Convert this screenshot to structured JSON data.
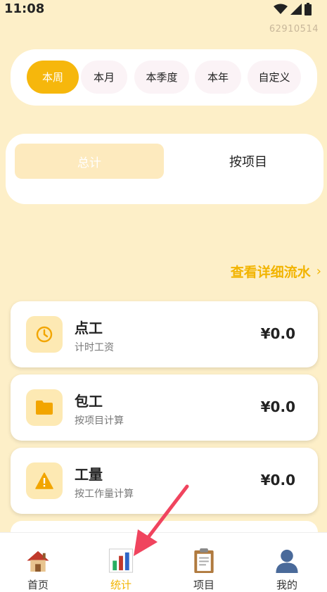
{
  "status_bar": {
    "time": "11:08"
  },
  "device_id": "62910514",
  "periods": [
    {
      "label": "本周",
      "active": true
    },
    {
      "label": "本月",
      "active": false
    },
    {
      "label": "本季度",
      "active": false
    },
    {
      "label": "本年",
      "active": false
    },
    {
      "label": "自定义",
      "active": false
    }
  ],
  "tabs": {
    "total_label": "总计",
    "by_project_label": "按项目"
  },
  "detail_link": {
    "label": "查看详细流水",
    "chevron": "›"
  },
  "stats": [
    {
      "title": "点工",
      "subtitle": "计时工资",
      "amount": "¥0.0",
      "icon": "clock-icon"
    },
    {
      "title": "包工",
      "subtitle": "按项目计算",
      "amount": "¥0.0",
      "icon": "folder-icon"
    },
    {
      "title": "工量",
      "subtitle": "按工作量计算",
      "amount": "¥0.0",
      "icon": "warning-icon"
    }
  ],
  "nav": [
    {
      "label": "首页",
      "icon": "house-icon",
      "active": false
    },
    {
      "label": "统计",
      "icon": "bar-chart-icon",
      "active": true
    },
    {
      "label": "项目",
      "icon": "clipboard-icon",
      "active": false
    },
    {
      "label": "我的",
      "icon": "user-icon",
      "active": false
    }
  ],
  "colors": {
    "accent": "#f6b70c",
    "background": "#fdefc8",
    "link": "#f2b400"
  }
}
